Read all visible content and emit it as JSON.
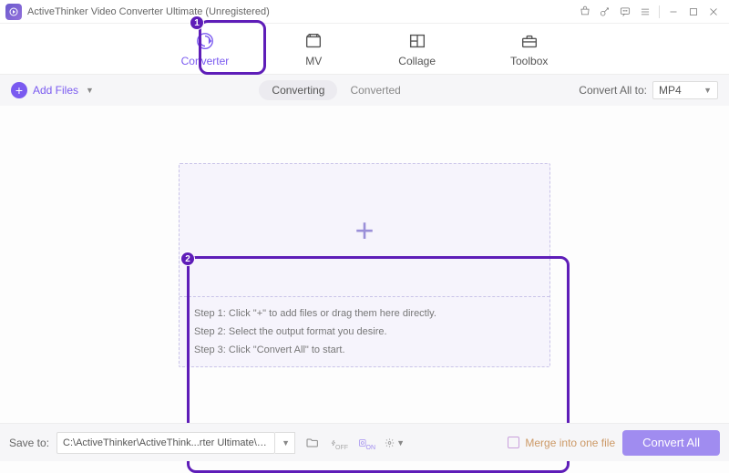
{
  "title": "ActiveThinker Video Converter Ultimate (Unregistered)",
  "nav": {
    "converter": "Converter",
    "mv": "MV",
    "collage": "Collage",
    "toolbox": "Toolbox"
  },
  "toolbar": {
    "add_files": "Add Files",
    "converting": "Converting",
    "converted": "Converted",
    "convert_all_to": "Convert All to:",
    "format": "MP4"
  },
  "dropzone": {
    "step1": "Step 1: Click \"+\" to add files or drag them here directly.",
    "step2": "Step 2: Select the output format you desire.",
    "step3": "Step 3: Click \"Convert All\" to start."
  },
  "bottom": {
    "save_to": "Save to:",
    "path": "C:\\ActiveThinker\\ActiveThink...rter Ultimate\\Converted",
    "merge": "Merge into one file",
    "convert_all": "Convert All"
  },
  "badges": {
    "one": "1",
    "two": "2"
  }
}
